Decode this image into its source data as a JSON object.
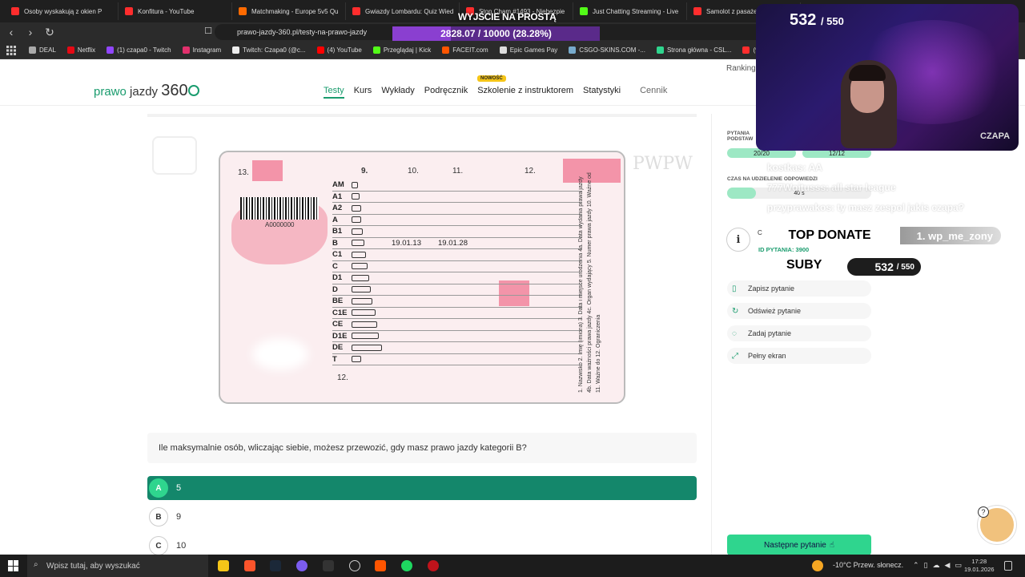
{
  "browser": {
    "tabs": [
      {
        "title": "Osoby wyskakują z okien P",
        "color": "#ff2d2d"
      },
      {
        "title": "Konfitura - YouTube",
        "color": "#ff2d2d"
      },
      {
        "title": "Matchmaking - Europe 5v5 Qu",
        "color": "#ff6a00"
      },
      {
        "title": "Gwiazdy Lombardu: Quiz Wied",
        "color": "#ff2d2d"
      },
      {
        "title": "Stop Cham #1493 - Niebezpie",
        "color": "#ff2d2d"
      },
      {
        "title": "Just Chatting Streaming - Live",
        "color": "#53fc18"
      },
      {
        "title": "Samolot z pasażera",
        "color": "#ff2d2d"
      }
    ],
    "url": "prawo-jazdy-360.pl/testy-na-prawo-jazdy",
    "bookmarks": [
      {
        "label": "DEAL",
        "color": "#aaa"
      },
      {
        "label": "Netflix",
        "color": "#e50914"
      },
      {
        "label": "(1) czapa0 - Twitch",
        "color": "#9146ff"
      },
      {
        "label": "Instagram",
        "color": "#e1306c"
      },
      {
        "label": "Twitch: Czapa0 (@c...",
        "color": "#eee"
      },
      {
        "label": "(4) YouTube",
        "color": "#ff0000"
      },
      {
        "label": "Przeglądaj | Kick",
        "color": "#53fc18"
      },
      {
        "label": "FACEIT.com",
        "color": "#ff5500"
      },
      {
        "label": "Epic Games Pay",
        "color": "#ddd"
      },
      {
        "label": "CSGO-SKINS.COM -...",
        "color": "#7ac"
      },
      {
        "label": "Strona główna - CSL...",
        "color": "#2fd58e"
      },
      {
        "label": "(9) Główne",
        "color": "#ff2d2d"
      }
    ]
  },
  "site": {
    "logo": {
      "part1": "prawo",
      "part2": "jazdy",
      "part3": "360"
    },
    "nav": [
      "Testy",
      "Kurs",
      "Wykłady",
      "Podręcznik",
      "Szkolenie z instruktorem",
      "Statystyki"
    ],
    "nav_extra": "Cennik",
    "badge_new": "NOWOŚĆ",
    "ranking": "Ranking"
  },
  "license": {
    "field13": "13.",
    "code": "A0000000",
    "headers": [
      "9.",
      "10.",
      "11.",
      "12."
    ],
    "rows": [
      {
        "cat": "AM",
        "d1": "",
        "d2": ""
      },
      {
        "cat": "A1",
        "d1": "",
        "d2": ""
      },
      {
        "cat": "A2",
        "d1": "",
        "d2": ""
      },
      {
        "cat": "A",
        "d1": "",
        "d2": ""
      },
      {
        "cat": "B1",
        "d1": "",
        "d2": ""
      },
      {
        "cat": "B",
        "d1": "19.01.13",
        "d2": "19.01.28"
      },
      {
        "cat": "C1",
        "d1": "",
        "d2": ""
      },
      {
        "cat": "C",
        "d1": "",
        "d2": ""
      },
      {
        "cat": "D1",
        "d1": "",
        "d2": ""
      },
      {
        "cat": "D",
        "d1": "",
        "d2": ""
      },
      {
        "cat": "BE",
        "d1": "",
        "d2": ""
      },
      {
        "cat": "C1E",
        "d1": "",
        "d2": ""
      },
      {
        "cat": "CE",
        "d1": "",
        "d2": ""
      },
      {
        "cat": "D1E",
        "d1": "",
        "d2": ""
      },
      {
        "cat": "DE",
        "d1": "",
        "d2": ""
      },
      {
        "cat": "T",
        "d1": "",
        "d2": ""
      }
    ],
    "field12": "12.",
    "vertical_text": "1. Nazwisko 2. Imię (imiona) 3. Data i miejsce urodzenia 4a. Data wydania prawa jazdy 4b. Data ważności prawa jazdy 4c. Organ wydający 5. Numer prawa jazdy 10. Ważne od 11. Ważne do 12. Ograniczenia",
    "watermark": "PWPW"
  },
  "question": {
    "text": "Ile maksymalnie osób, wliczając siebie, możesz przewozić, gdy masz prawo jazdy kategorii B?",
    "answers": [
      {
        "letter": "A",
        "text": "5",
        "selected": true
      },
      {
        "letter": "B",
        "text": "9",
        "selected": false
      },
      {
        "letter": "C",
        "text": "10",
        "selected": false
      }
    ]
  },
  "panel": {
    "label_questions": "PYTANIA",
    "label_basic": "PODSTAW",
    "basic_count": "20/20",
    "special_count": "12/12",
    "label_time": "CZAS NA UDZIELENIE ODPOWIEDZI",
    "time": "40 s",
    "info_icon": "i",
    "c_letter": "C",
    "question_id": "ID PYTANIA: 3900",
    "actions": [
      {
        "label": "Zapisz pytanie",
        "icon": "bookmark-icon",
        "glyph": "🔖"
      },
      {
        "label": "Odśwież pytanie",
        "icon": "refresh-icon",
        "glyph": "↻"
      },
      {
        "label": "Zadaj pytanie",
        "icon": "chat-icon",
        "glyph": "💬"
      },
      {
        "label": "Pełny ekran",
        "icon": "fullscreen-icon",
        "glyph": "⤢"
      }
    ],
    "next_button": "Następne pytanie"
  },
  "overlay": {
    "title": "WYJŚCIE NA PROSTĄ",
    "progress_text": "2828.07 / 10000 (28.28%)",
    "progress_fraction": 0.2828,
    "cam_count": "532",
    "cam_total": "/ 550",
    "cam_name": "CZAPA",
    "chat": [
      "kostkas: AA",
      "777Wojtusss: all star league",
      "przyprawakos: ty masz zespol jakis czapa?"
    ],
    "top_donate_label": "TOP DONATE",
    "top_donate_value": "1. wp_me_zony",
    "suby_label": "SUBY",
    "suby_count": "532",
    "suby_total": "/ 550"
  },
  "taskbar": {
    "search_placeholder": "Wpisz tutaj, aby wyszukać",
    "weather": "-10°C  Przew. słonecz.",
    "time": "17:28",
    "date": "19.01.2026"
  }
}
